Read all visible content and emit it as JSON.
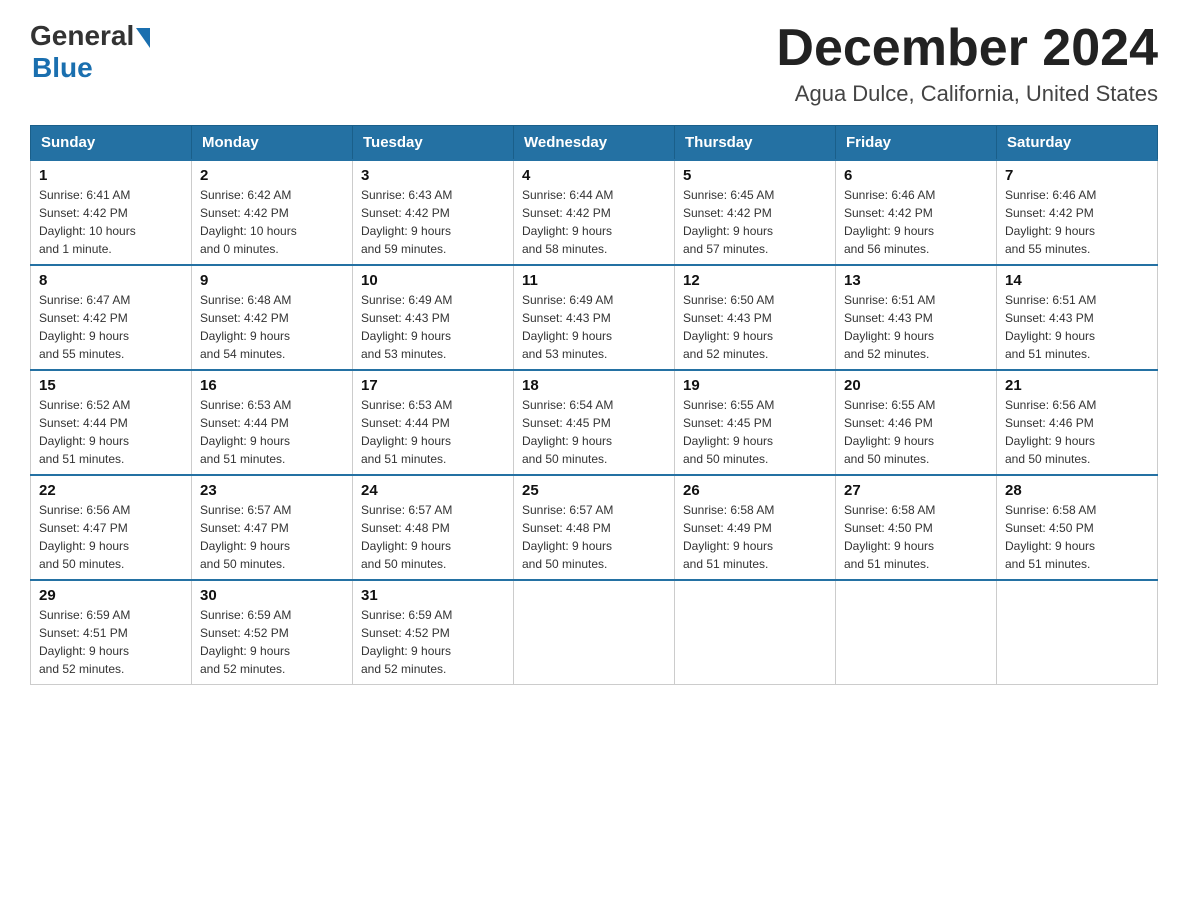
{
  "header": {
    "logo_general": "General",
    "logo_blue": "Blue",
    "month_title": "December 2024",
    "location": "Agua Dulce, California, United States"
  },
  "days_of_week": [
    "Sunday",
    "Monday",
    "Tuesday",
    "Wednesday",
    "Thursday",
    "Friday",
    "Saturday"
  ],
  "weeks": [
    [
      {
        "day": "1",
        "sunrise": "6:41 AM",
        "sunset": "4:42 PM",
        "daylight": "10 hours and 1 minute."
      },
      {
        "day": "2",
        "sunrise": "6:42 AM",
        "sunset": "4:42 PM",
        "daylight": "10 hours and 0 minutes."
      },
      {
        "day": "3",
        "sunrise": "6:43 AM",
        "sunset": "4:42 PM",
        "daylight": "9 hours and 59 minutes."
      },
      {
        "day": "4",
        "sunrise": "6:44 AM",
        "sunset": "4:42 PM",
        "daylight": "9 hours and 58 minutes."
      },
      {
        "day": "5",
        "sunrise": "6:45 AM",
        "sunset": "4:42 PM",
        "daylight": "9 hours and 57 minutes."
      },
      {
        "day": "6",
        "sunrise": "6:46 AM",
        "sunset": "4:42 PM",
        "daylight": "9 hours and 56 minutes."
      },
      {
        "day": "7",
        "sunrise": "6:46 AM",
        "sunset": "4:42 PM",
        "daylight": "9 hours and 55 minutes."
      }
    ],
    [
      {
        "day": "8",
        "sunrise": "6:47 AM",
        "sunset": "4:42 PM",
        "daylight": "9 hours and 55 minutes."
      },
      {
        "day": "9",
        "sunrise": "6:48 AM",
        "sunset": "4:42 PM",
        "daylight": "9 hours and 54 minutes."
      },
      {
        "day": "10",
        "sunrise": "6:49 AM",
        "sunset": "4:43 PM",
        "daylight": "9 hours and 53 minutes."
      },
      {
        "day": "11",
        "sunrise": "6:49 AM",
        "sunset": "4:43 PM",
        "daylight": "9 hours and 53 minutes."
      },
      {
        "day": "12",
        "sunrise": "6:50 AM",
        "sunset": "4:43 PM",
        "daylight": "9 hours and 52 minutes."
      },
      {
        "day": "13",
        "sunrise": "6:51 AM",
        "sunset": "4:43 PM",
        "daylight": "9 hours and 52 minutes."
      },
      {
        "day": "14",
        "sunrise": "6:51 AM",
        "sunset": "4:43 PM",
        "daylight": "9 hours and 51 minutes."
      }
    ],
    [
      {
        "day": "15",
        "sunrise": "6:52 AM",
        "sunset": "4:44 PM",
        "daylight": "9 hours and 51 minutes."
      },
      {
        "day": "16",
        "sunrise": "6:53 AM",
        "sunset": "4:44 PM",
        "daylight": "9 hours and 51 minutes."
      },
      {
        "day": "17",
        "sunrise": "6:53 AM",
        "sunset": "4:44 PM",
        "daylight": "9 hours and 51 minutes."
      },
      {
        "day": "18",
        "sunrise": "6:54 AM",
        "sunset": "4:45 PM",
        "daylight": "9 hours and 50 minutes."
      },
      {
        "day": "19",
        "sunrise": "6:55 AM",
        "sunset": "4:45 PM",
        "daylight": "9 hours and 50 minutes."
      },
      {
        "day": "20",
        "sunrise": "6:55 AM",
        "sunset": "4:46 PM",
        "daylight": "9 hours and 50 minutes."
      },
      {
        "day": "21",
        "sunrise": "6:56 AM",
        "sunset": "4:46 PM",
        "daylight": "9 hours and 50 minutes."
      }
    ],
    [
      {
        "day": "22",
        "sunrise": "6:56 AM",
        "sunset": "4:47 PM",
        "daylight": "9 hours and 50 minutes."
      },
      {
        "day": "23",
        "sunrise": "6:57 AM",
        "sunset": "4:47 PM",
        "daylight": "9 hours and 50 minutes."
      },
      {
        "day": "24",
        "sunrise": "6:57 AM",
        "sunset": "4:48 PM",
        "daylight": "9 hours and 50 minutes."
      },
      {
        "day": "25",
        "sunrise": "6:57 AM",
        "sunset": "4:48 PM",
        "daylight": "9 hours and 50 minutes."
      },
      {
        "day": "26",
        "sunrise": "6:58 AM",
        "sunset": "4:49 PM",
        "daylight": "9 hours and 51 minutes."
      },
      {
        "day": "27",
        "sunrise": "6:58 AM",
        "sunset": "4:50 PM",
        "daylight": "9 hours and 51 minutes."
      },
      {
        "day": "28",
        "sunrise": "6:58 AM",
        "sunset": "4:50 PM",
        "daylight": "9 hours and 51 minutes."
      }
    ],
    [
      {
        "day": "29",
        "sunrise": "6:59 AM",
        "sunset": "4:51 PM",
        "daylight": "9 hours and 52 minutes."
      },
      {
        "day": "30",
        "sunrise": "6:59 AM",
        "sunset": "4:52 PM",
        "daylight": "9 hours and 52 minutes."
      },
      {
        "day": "31",
        "sunrise": "6:59 AM",
        "sunset": "4:52 PM",
        "daylight": "9 hours and 52 minutes."
      },
      null,
      null,
      null,
      null
    ]
  ],
  "labels": {
    "sunrise": "Sunrise:",
    "sunset": "Sunset:",
    "daylight": "Daylight:"
  }
}
